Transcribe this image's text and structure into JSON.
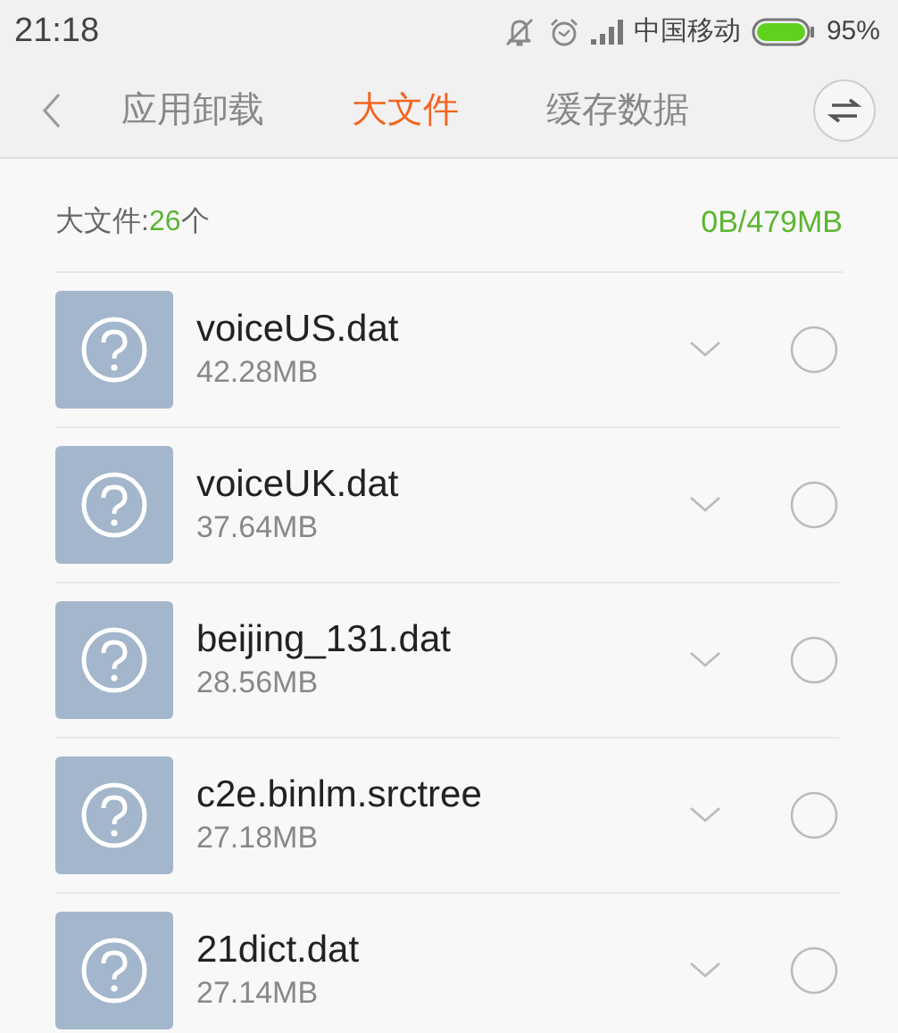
{
  "status_bar": {
    "time": "21:18",
    "carrier": "中国移动",
    "battery": "95%"
  },
  "tabs": [
    {
      "label": "应用卸载",
      "selected": false
    },
    {
      "label": "大文件",
      "selected": true
    },
    {
      "label": "缓存数据",
      "selected": false
    }
  ],
  "summary": {
    "label": "大文件:",
    "count": "26",
    "unit": "个",
    "selected_size": "0B/479MB"
  },
  "files": [
    {
      "name": "voiceUS.dat",
      "size": "42.28MB",
      "checked": false
    },
    {
      "name": "voiceUK.dat",
      "size": "37.64MB",
      "checked": false
    },
    {
      "name": "beijing_131.dat",
      "size": "28.56MB",
      "checked": false
    },
    {
      "name": "c2e.binlm.srctree",
      "size": "27.18MB",
      "checked": false
    },
    {
      "name": "21dict.dat",
      "size": "27.14MB",
      "checked": false
    }
  ]
}
